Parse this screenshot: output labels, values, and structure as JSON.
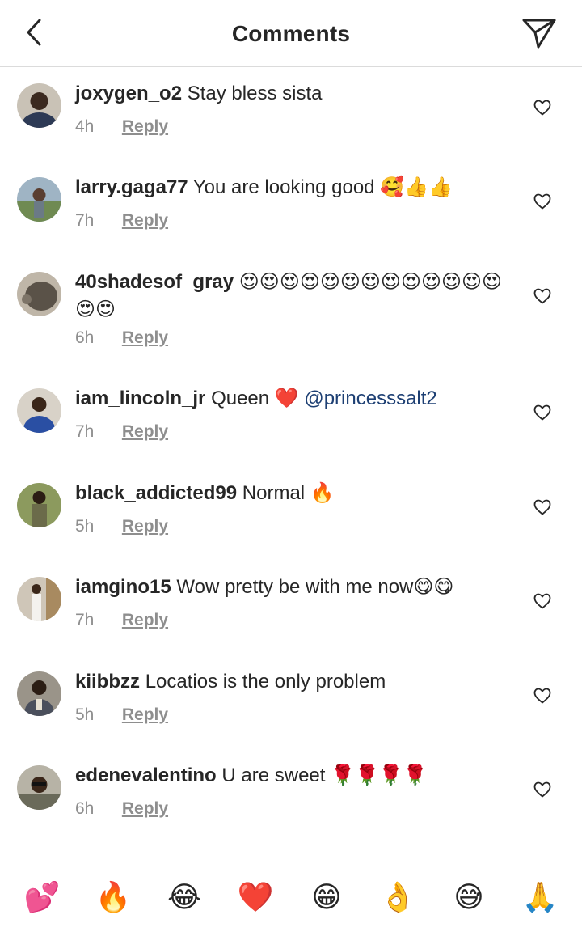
{
  "header": {
    "title": "Comments",
    "back_icon": "chevron-left-icon",
    "send_icon": "paper-plane-icon"
  },
  "comments": [
    {
      "username": "joxygen_o2",
      "text": "Stay bless sista",
      "time": "4h",
      "reply_label": "Reply",
      "avatar_color": "#2d3a55"
    },
    {
      "username": "larry.gaga77",
      "text": "You are looking good 🥰👍👍",
      "time": "7h",
      "reply_label": "Reply",
      "avatar_color": "#6b7a86"
    },
    {
      "username": "40shadesof_gray",
      "text": "😍😍😍😍😍😍😍😍😍😍😍😍😍😍😍",
      "time": "6h",
      "reply_label": "Reply",
      "avatar_color": "#5a5248"
    },
    {
      "username": "iam_lincoln_jr",
      "text": "Queen ❤️",
      "mention": "@princesssalt2",
      "time": "7h",
      "reply_label": "Reply",
      "avatar_color": "#2a4fa3"
    },
    {
      "username": "black_addicted99",
      "text": "Normal 🔥",
      "time": "5h",
      "reply_label": "Reply",
      "avatar_color": "#6b6b4a"
    },
    {
      "username": "iamgino15",
      "text": "Wow pretty be with me now😋😋",
      "time": "7h",
      "reply_label": "Reply",
      "avatar_color": "#d9d4cc"
    },
    {
      "username": "kiibbzz",
      "text": "Locatios is the only problem",
      "time": "5h",
      "reply_label": "Reply",
      "avatar_color": "#4a4f5c"
    },
    {
      "username": "edenevalentino",
      "text": "U are sweet 🌹🌹🌹🌹",
      "time": "6h",
      "reply_label": "Reply",
      "avatar_color": "#8a8a7a"
    }
  ],
  "emoji_bar": [
    "💕",
    "🔥",
    "😂",
    "❤️",
    "😁",
    "👌",
    "😅",
    "🙏"
  ],
  "colors": {
    "text": "#262626",
    "secondary": "#8e8e8e",
    "mention": "#1d3f73",
    "divider": "#dbdbdb"
  }
}
